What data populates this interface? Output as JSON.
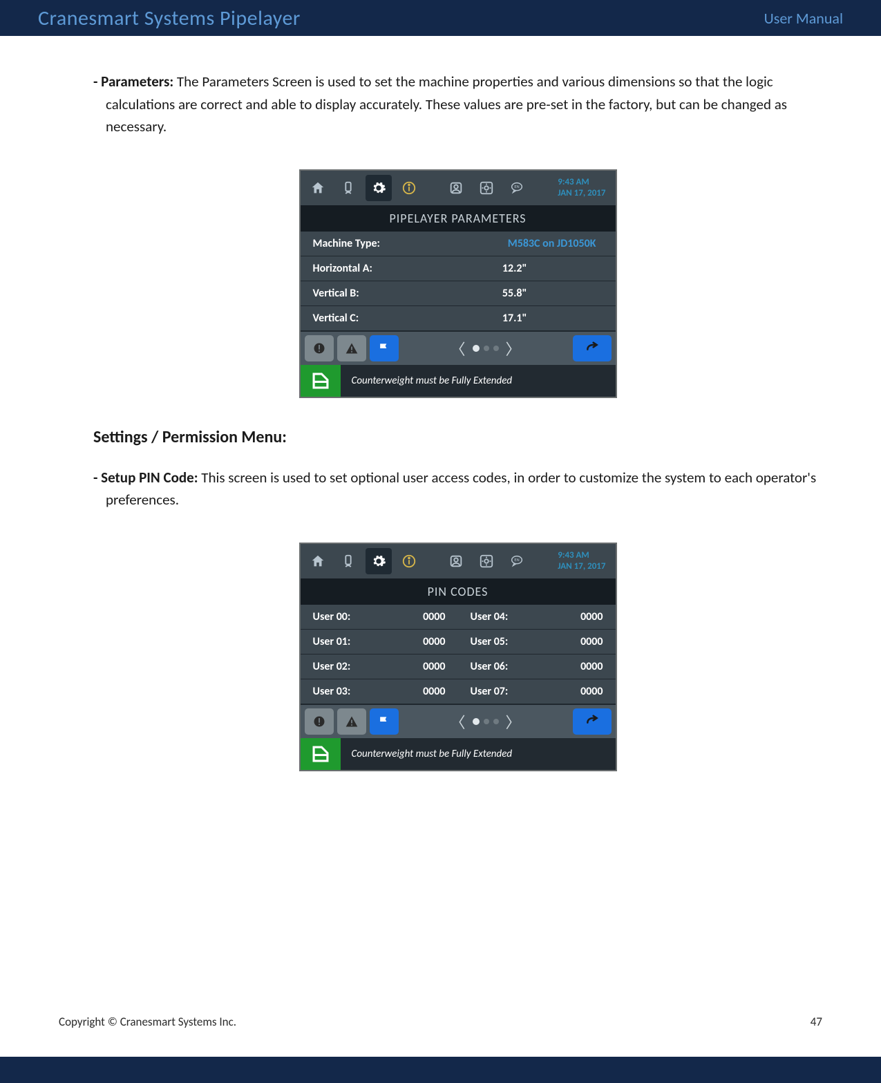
{
  "header": {
    "title": "Cranesmart Systems Pipelayer",
    "right": "User Manual"
  },
  "sectionA": {
    "lead": "- Parameters:",
    "body": "  The Parameters Screen is used to set the machine properties and various dimensions so that the logic calculations are correct and able to display accurately.  These values are pre-set in the factory, but can be changed as necessary."
  },
  "headingB": "Settings / Permission Menu:",
  "sectionC": {
    "lead": "- Setup PIN Code:",
    "body": "  This screen is used to set optional user access codes, in order to customize the system to each operator's preferences."
  },
  "screens": {
    "time": "9:43 AM",
    "date": "JAN 17, 2017",
    "statusMsg": "Counterweight must be Fully Extended",
    "params": {
      "title": "PIPELAYER PARAMETERS",
      "rows": [
        {
          "label": "Machine Type:",
          "value": "M583C on JD1050K",
          "highlight": true
        },
        {
          "label": "Horizontal A:",
          "value": "12.2\""
        },
        {
          "label": "Vertical B:",
          "value": "55.8\""
        },
        {
          "label": "Vertical C:",
          "value": "17.1\""
        }
      ]
    },
    "pins": {
      "title": "PIN CODES",
      "left": [
        {
          "label": "User 00:",
          "value": "0000"
        },
        {
          "label": "User 01:",
          "value": "0000"
        },
        {
          "label": "User 02:",
          "value": "0000"
        },
        {
          "label": "User 03:",
          "value": "0000"
        }
      ],
      "right": [
        {
          "label": "User 04:",
          "value": "0000"
        },
        {
          "label": "User 05:",
          "value": "0000"
        },
        {
          "label": "User 06:",
          "value": "0000"
        },
        {
          "label": "User 07:",
          "value": "0000"
        }
      ]
    }
  },
  "footer": {
    "copyright": "Copyright © Cranesmart Systems Inc.",
    "page": "47"
  }
}
